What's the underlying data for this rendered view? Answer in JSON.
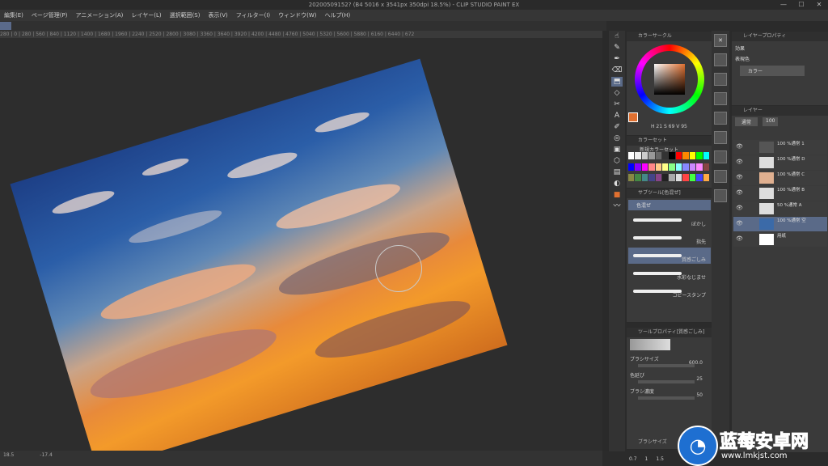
{
  "window": {
    "title": "20200509152? (B4 5016 x 3541px 350dpi 18.5%) - CLIP STUDIO PAINT EX",
    "controls": [
      "—",
      "☐",
      "✕"
    ]
  },
  "menu": [
    "編集(E)",
    "ページ管理(P)",
    "アニメーション(A)",
    "レイヤー(L)",
    "選択範囲(S)",
    "表示(V)",
    "フィルター(I)",
    "ウィンドウ(W)",
    "ヘルプ(H)"
  ],
  "ruler_ticks": "280 | 0 | 280 | 560 | 840 | 1120 | 1400 | 1680 | 1960 | 2240 | 2520 | 2800 | 3080 | 3360 | 3640 | 3920 | 4200 | 4480 | 4760 | 5040 | 5320 | 5600 | 5880 | 6160 | 6440 | 672",
  "statusbar": {
    "zoom": "18.5",
    "angle": "-17.4"
  },
  "tools": [
    "☝",
    "✎",
    "✒",
    "⌫",
    "⬒",
    "◇",
    "✂",
    "A",
    "✐",
    "◎",
    "▣",
    "⬡",
    "▤",
    "◐",
    "■",
    "〰"
  ],
  "colorwheel": {
    "title": "カラーサークル",
    "readout": "H 21  S 69  V 95",
    "main_color": "#e07030"
  },
  "colorset": {
    "title": "カラーセット",
    "set_name": "新規カラーセット"
  },
  "subtool": {
    "title": "サブツール[色混ぜ]",
    "group": "色混ぜ",
    "brushes": [
      {
        "label": "ぼかし",
        "selected": false
      },
      {
        "label": "指先",
        "selected": false
      },
      {
        "label": "質感ごしみ",
        "selected": true
      },
      {
        "label": "水彩なじませ",
        "selected": false
      },
      {
        "label": "コピースタンプ",
        "selected": false
      }
    ]
  },
  "toolprop": {
    "title": "ツールプロパティ[質感ごしみ]",
    "rows": [
      {
        "label": "ブラシサイズ",
        "value": "600.0"
      },
      {
        "label": "色延び",
        "value": "25"
      },
      {
        "label": "ブラシ濃度",
        "value": "50"
      }
    ],
    "bottom_title": "ブラシサイズ",
    "bottom_values": [
      "0.7",
      "1",
      "1.5"
    ]
  },
  "layerprop": {
    "title": "レイヤープロパティ",
    "effect_label": "効果",
    "expression_label": "表現色",
    "expression_value": "カラー"
  },
  "layers": {
    "title": "レイヤー",
    "blend": "通常",
    "opacity": "100",
    "rows": [
      {
        "name": "100 %通常\n1",
        "selected": false,
        "thumb": "#555"
      },
      {
        "name": "100 %通常\nD",
        "selected": false,
        "thumb": "#ddd"
      },
      {
        "name": "100 %通常\nC",
        "selected": false,
        "thumb": "#e0b090"
      },
      {
        "name": "100 %通常\nB",
        "selected": false,
        "thumb": "#ddd"
      },
      {
        "name": "50 %通常\nA",
        "selected": false,
        "thumb": "#ddd"
      },
      {
        "name": "100 %通常\n空",
        "selected": true,
        "thumb": "#3b6aa8"
      },
      {
        "name": "用紙",
        "selected": false,
        "thumb": "#fff"
      }
    ]
  },
  "watermark": {
    "title": "蓝莓安卓网",
    "url": "www.lmkjst.com"
  }
}
